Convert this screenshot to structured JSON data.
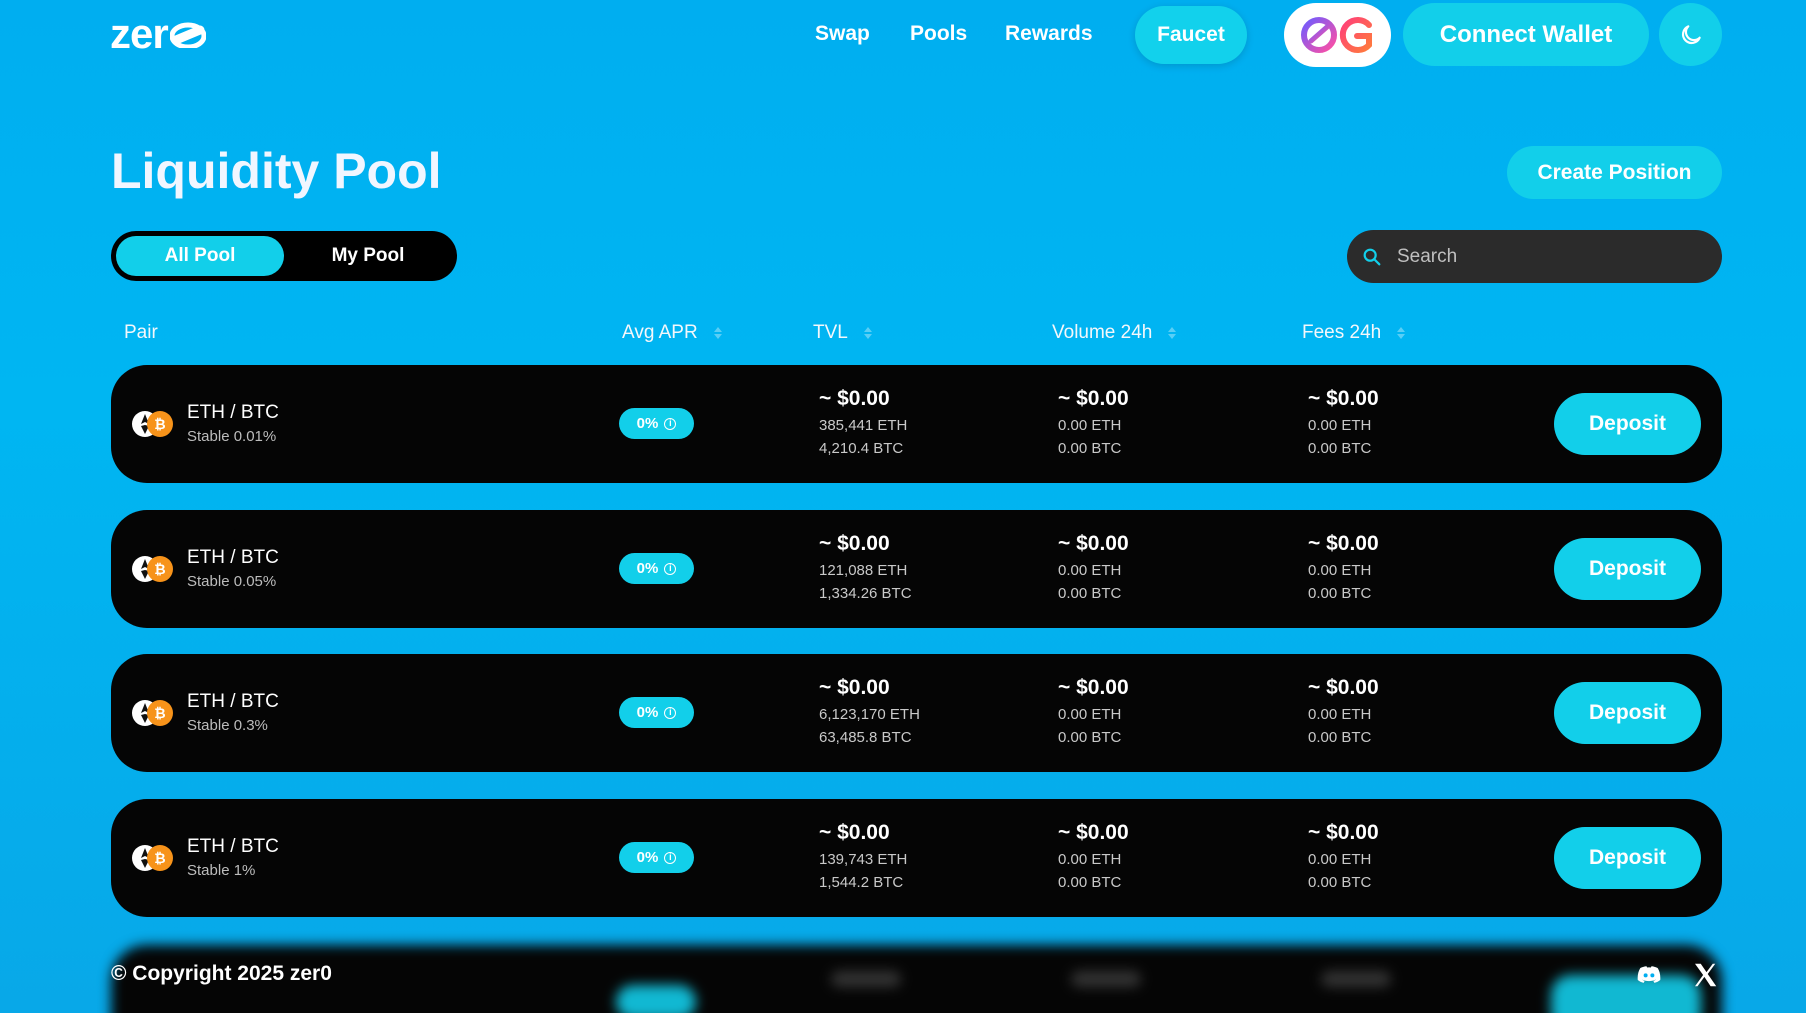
{
  "nav": {
    "logo_text": "zer",
    "links": [
      "Swap",
      "Pools",
      "Rewards"
    ],
    "faucet_label": "Faucet",
    "connect_label": "Connect Wallet",
    "theme_icon": "moon-icon",
    "network_icon": "network-logo-icon"
  },
  "header": {
    "title": "Liquidity Pool",
    "create_label": "Create Position",
    "tabs": [
      "All Pool",
      "My Pool"
    ],
    "active_tab": "All Pool",
    "search_placeholder": "Search"
  },
  "table": {
    "columns": [
      "Pair",
      "Avg APR",
      "TVL",
      "Volume 24h",
      "Fees 24h"
    ],
    "rows": [
      {
        "pair": "ETH / BTC",
        "fee_tier": "Stable 0.01%",
        "apr": "0%",
        "tvl": "~ $0.00",
        "tvl_eth": "385,441 ETH",
        "tvl_btc": "4,210.4 BTC",
        "vol": "~ $0.00",
        "vol_eth": "0.00 ETH",
        "vol_btc": "0.00 BTC",
        "fees": "~ $0.00",
        "fees_eth": "0.00 ETH",
        "fees_btc": "0.00 BTC",
        "action": "Deposit"
      },
      {
        "pair": "ETH / BTC",
        "fee_tier": "Stable 0.05%",
        "apr": "0%",
        "tvl": "~ $0.00",
        "tvl_eth": "121,088 ETH",
        "tvl_btc": "1,334.26 BTC",
        "vol": "~ $0.00",
        "vol_eth": "0.00 ETH",
        "vol_btc": "0.00 BTC",
        "fees": "~ $0.00",
        "fees_eth": "0.00 ETH",
        "fees_btc": "0.00 BTC",
        "action": "Deposit"
      },
      {
        "pair": "ETH / BTC",
        "fee_tier": "Stable 0.3%",
        "apr": "0%",
        "tvl": "~ $0.00",
        "tvl_eth": "6,123,170 ETH",
        "tvl_btc": "63,485.8 BTC",
        "vol": "~ $0.00",
        "vol_eth": "0.00 ETH",
        "vol_btc": "0.00 BTC",
        "fees": "~ $0.00",
        "fees_eth": "0.00 ETH",
        "fees_btc": "0.00 BTC",
        "action": "Deposit"
      },
      {
        "pair": "ETH / BTC",
        "fee_tier": "Stable 1%",
        "apr": "0%",
        "tvl": "~ $0.00",
        "tvl_eth": "139,743 ETH",
        "tvl_btc": "1,544.2 BTC",
        "vol": "~ $0.00",
        "vol_eth": "0.00 ETH",
        "vol_btc": "0.00 BTC",
        "fees": "~ $0.00",
        "fees_eth": "0.00 ETH",
        "fees_btc": "0.00 BTC",
        "action": "Deposit"
      }
    ]
  },
  "footer": {
    "copyright": "© Copyright 2025 zer0",
    "social_icons": [
      "discord-icon",
      "x-icon"
    ]
  },
  "colors": {
    "background": "#00b0f0",
    "accent": "#12cfea",
    "row_bg": "#050505",
    "search_bg": "#2b2b2b"
  }
}
